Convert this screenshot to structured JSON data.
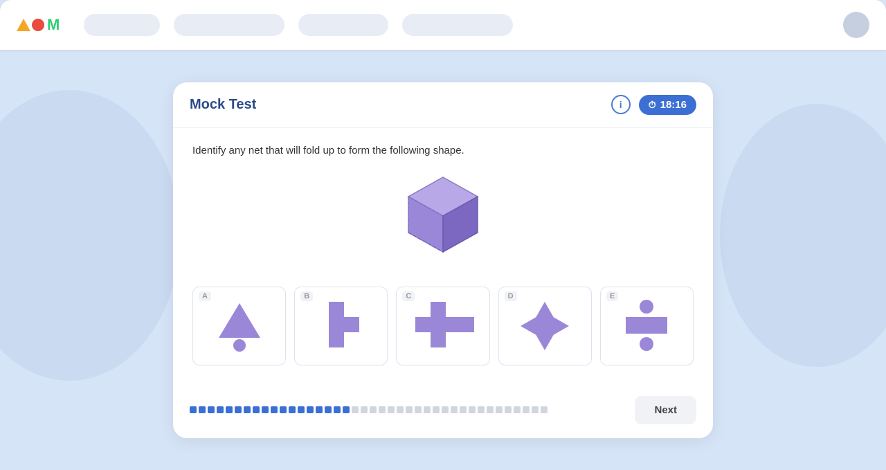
{
  "navbar": {
    "logo_alt": "Atom Logo",
    "nav_pills": [
      "pill1",
      "pill2",
      "pill3",
      "pill4"
    ]
  },
  "card": {
    "title": "Mock Test",
    "timer_label": "18:16",
    "info_label": "i",
    "question": "Identify any net that will fold up to form the following shape.",
    "options": [
      {
        "label": "A",
        "shape": "triangle-circle"
      },
      {
        "label": "B",
        "shape": "t-shape"
      },
      {
        "label": "C",
        "shape": "cross-wide"
      },
      {
        "label": "D",
        "shape": "diamond"
      },
      {
        "label": "E",
        "shape": "rectangle-circles"
      }
    ],
    "next_button_label": "Next",
    "progress": {
      "filled": 18,
      "total": 40
    }
  }
}
